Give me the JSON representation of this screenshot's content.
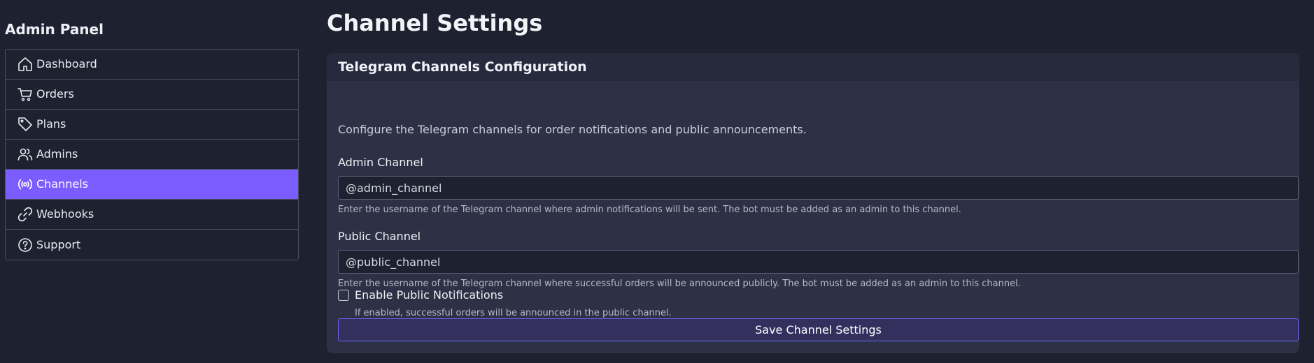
{
  "sidebar": {
    "title": "Admin Panel",
    "items": [
      {
        "label": "Dashboard",
        "icon": "home-icon",
        "active": false
      },
      {
        "label": "Orders",
        "icon": "cart-icon",
        "active": false
      },
      {
        "label": "Plans",
        "icon": "tag-icon",
        "active": false
      },
      {
        "label": "Admins",
        "icon": "users-icon",
        "active": false
      },
      {
        "label": "Channels",
        "icon": "broadcast-icon",
        "active": true
      },
      {
        "label": "Webhooks",
        "icon": "link-icon",
        "active": false
      },
      {
        "label": "Support",
        "icon": "help-circle-icon",
        "active": false
      }
    ]
  },
  "main": {
    "title": "Channel Settings",
    "card": {
      "header": "Telegram Channels Configuration",
      "description": "Configure the Telegram channels for order notifications and public announcements.",
      "admin_channel": {
        "label": "Admin Channel",
        "value": "@admin_channel",
        "help": "Enter the username of the Telegram channel where admin notifications will be sent. The bot must be added as an admin to this channel."
      },
      "public_channel": {
        "label": "Public Channel",
        "value": "@public_channel",
        "help": "Enter the username of the Telegram channel where successful orders will be announced publicly. The bot must be added as an admin to this channel."
      },
      "public_notifications": {
        "label": "Enable Public Notifications",
        "checked": false,
        "help": "If enabled, successful orders will be announced in the public channel."
      },
      "save_label": "Save Channel Settings"
    }
  },
  "colors": {
    "background": "#1e2130",
    "card": "#2d3145",
    "accent": "#7b5cff",
    "button": "#34305e"
  }
}
